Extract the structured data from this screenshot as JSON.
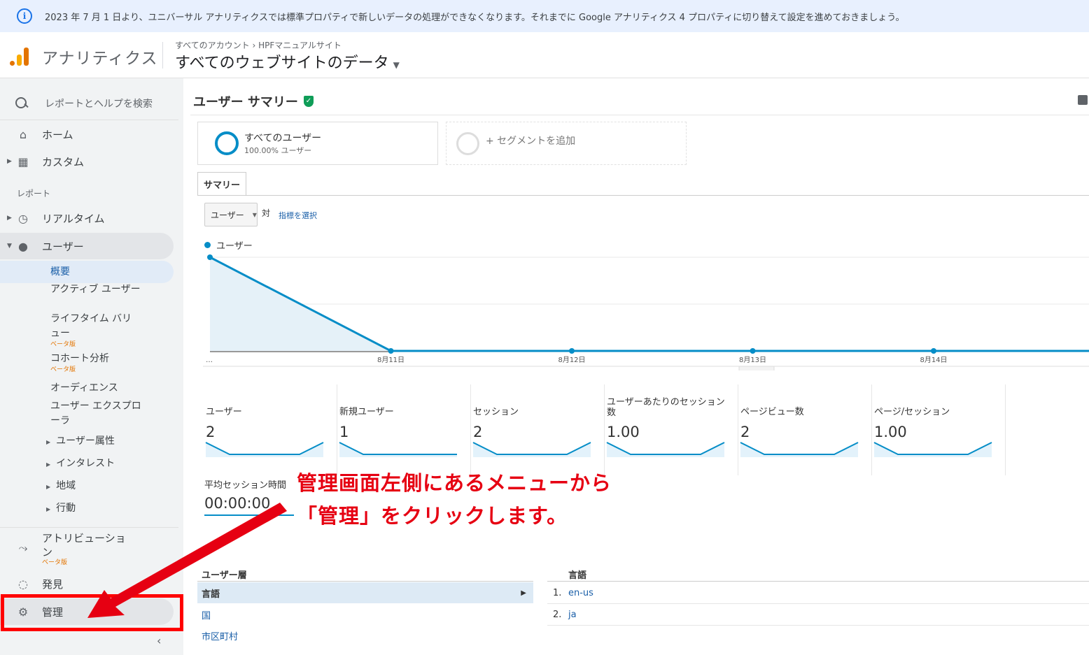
{
  "banner": {
    "text": "2023 年 7 月 1 日より、ユニバーサル アナリティクスでは標準プロパティで新しいデータの処理ができなくなります。それまでに Google アナリティクス 4 プロパティに切り替えて設定を進めておきましょう。"
  },
  "header": {
    "app_title": "アナリティクス",
    "breadcrumb": "すべてのアカウント › HPFマニュアルサイト",
    "property": "すべてのウェブサイトのデータ"
  },
  "sidebar": {
    "search_placeholder": "レポートとヘルプを検索",
    "home": "ホーム",
    "custom": "カスタム",
    "reports_label": "レポート",
    "realtime": "リアルタイム",
    "users": "ユーザー",
    "overview": "概要",
    "active_users": "アクティブ ユーザー",
    "lifetime_value": "ライフタイム バリュー",
    "cohort": "コホート分析",
    "beta": "ベータ版",
    "audiences": "オーディエンス",
    "user_explorer": "ユーザー エクスプローラ",
    "user_attributes": "ユーザー属性",
    "interests": "インタレスト",
    "geo": "地域",
    "behavior": "行動",
    "attribution": "アトリビューション",
    "discover": "発見",
    "admin": "管理"
  },
  "main": {
    "title": "ユーザー サマリー",
    "segments": [
      {
        "name": "すべてのユーザー",
        "sub": "100.00% ユーザー"
      },
      {
        "name": "+ セグメントを追加"
      }
    ],
    "tab": "サマリー",
    "metric_select": "ユーザー",
    "vs": "対",
    "pick_metric": "指標を選択",
    "legend": "ユーザー"
  },
  "chart_data": {
    "type": "area",
    "x": [
      "…",
      "8月11日",
      "8月12日",
      "8月13日",
      "8月14日"
    ],
    "series": [
      {
        "name": "ユーザー",
        "values": [
          1,
          0,
          0,
          0,
          0
        ]
      }
    ],
    "y_ticks": [
      "1",
      "0.5"
    ],
    "ylim": [
      0,
      1
    ],
    "grid": true,
    "color": "#058dc7"
  },
  "scorecards": [
    {
      "name": "ユーザー",
      "value": "2"
    },
    {
      "name": "新規ユーザー",
      "value": "1"
    },
    {
      "name": "セッション",
      "value": "2"
    },
    {
      "name": "ユーザーあたりのセッション数",
      "value": "1.00"
    },
    {
      "name": "ページビュー数",
      "value": "2"
    },
    {
      "name": "ページ/セッション",
      "value": "1.00"
    }
  ],
  "avg_session": {
    "name": "平均セッション時間",
    "value": "00:00:00"
  },
  "table": {
    "left_header": "ユーザー層",
    "right_header": "言語",
    "dimensions": [
      "言語",
      "国",
      "市区町村"
    ],
    "rows": [
      {
        "num": "1.",
        "value": "en-us"
      },
      {
        "num": "2.",
        "value": "ja"
      }
    ]
  },
  "annotation": {
    "line1": "管理画面左側にあるメニューから",
    "line2": "「管理」をクリックします。",
    "color": "#e60012"
  }
}
